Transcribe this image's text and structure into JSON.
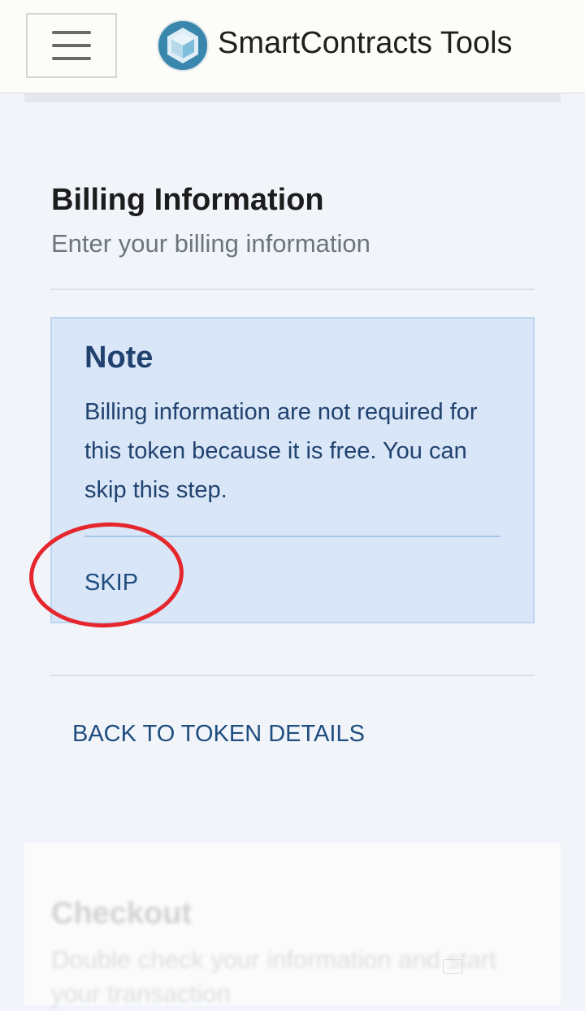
{
  "header": {
    "menu_icon": "hamburger-menu-icon",
    "logo_icon": "cube-hexagon-logo-icon",
    "brand": "SmartContracts Tools"
  },
  "billing": {
    "title": "Billing Information",
    "subtitle": "Enter your billing information"
  },
  "note": {
    "title": "Note",
    "body": "Billing information are not required for this token because it is free. You can skip this step.",
    "skip_label": "SKIP"
  },
  "nav": {
    "back_label": "BACK TO TOKEN DETAILS"
  },
  "checkout": {
    "title": "Checkout",
    "subtitle": "Double check your information and start your transaction"
  },
  "colors": {
    "accent_link": "#1f4d80",
    "note_bg": "#d8e6f7",
    "annotation_circle": "#e6262d",
    "logo": "#3a87ad"
  }
}
